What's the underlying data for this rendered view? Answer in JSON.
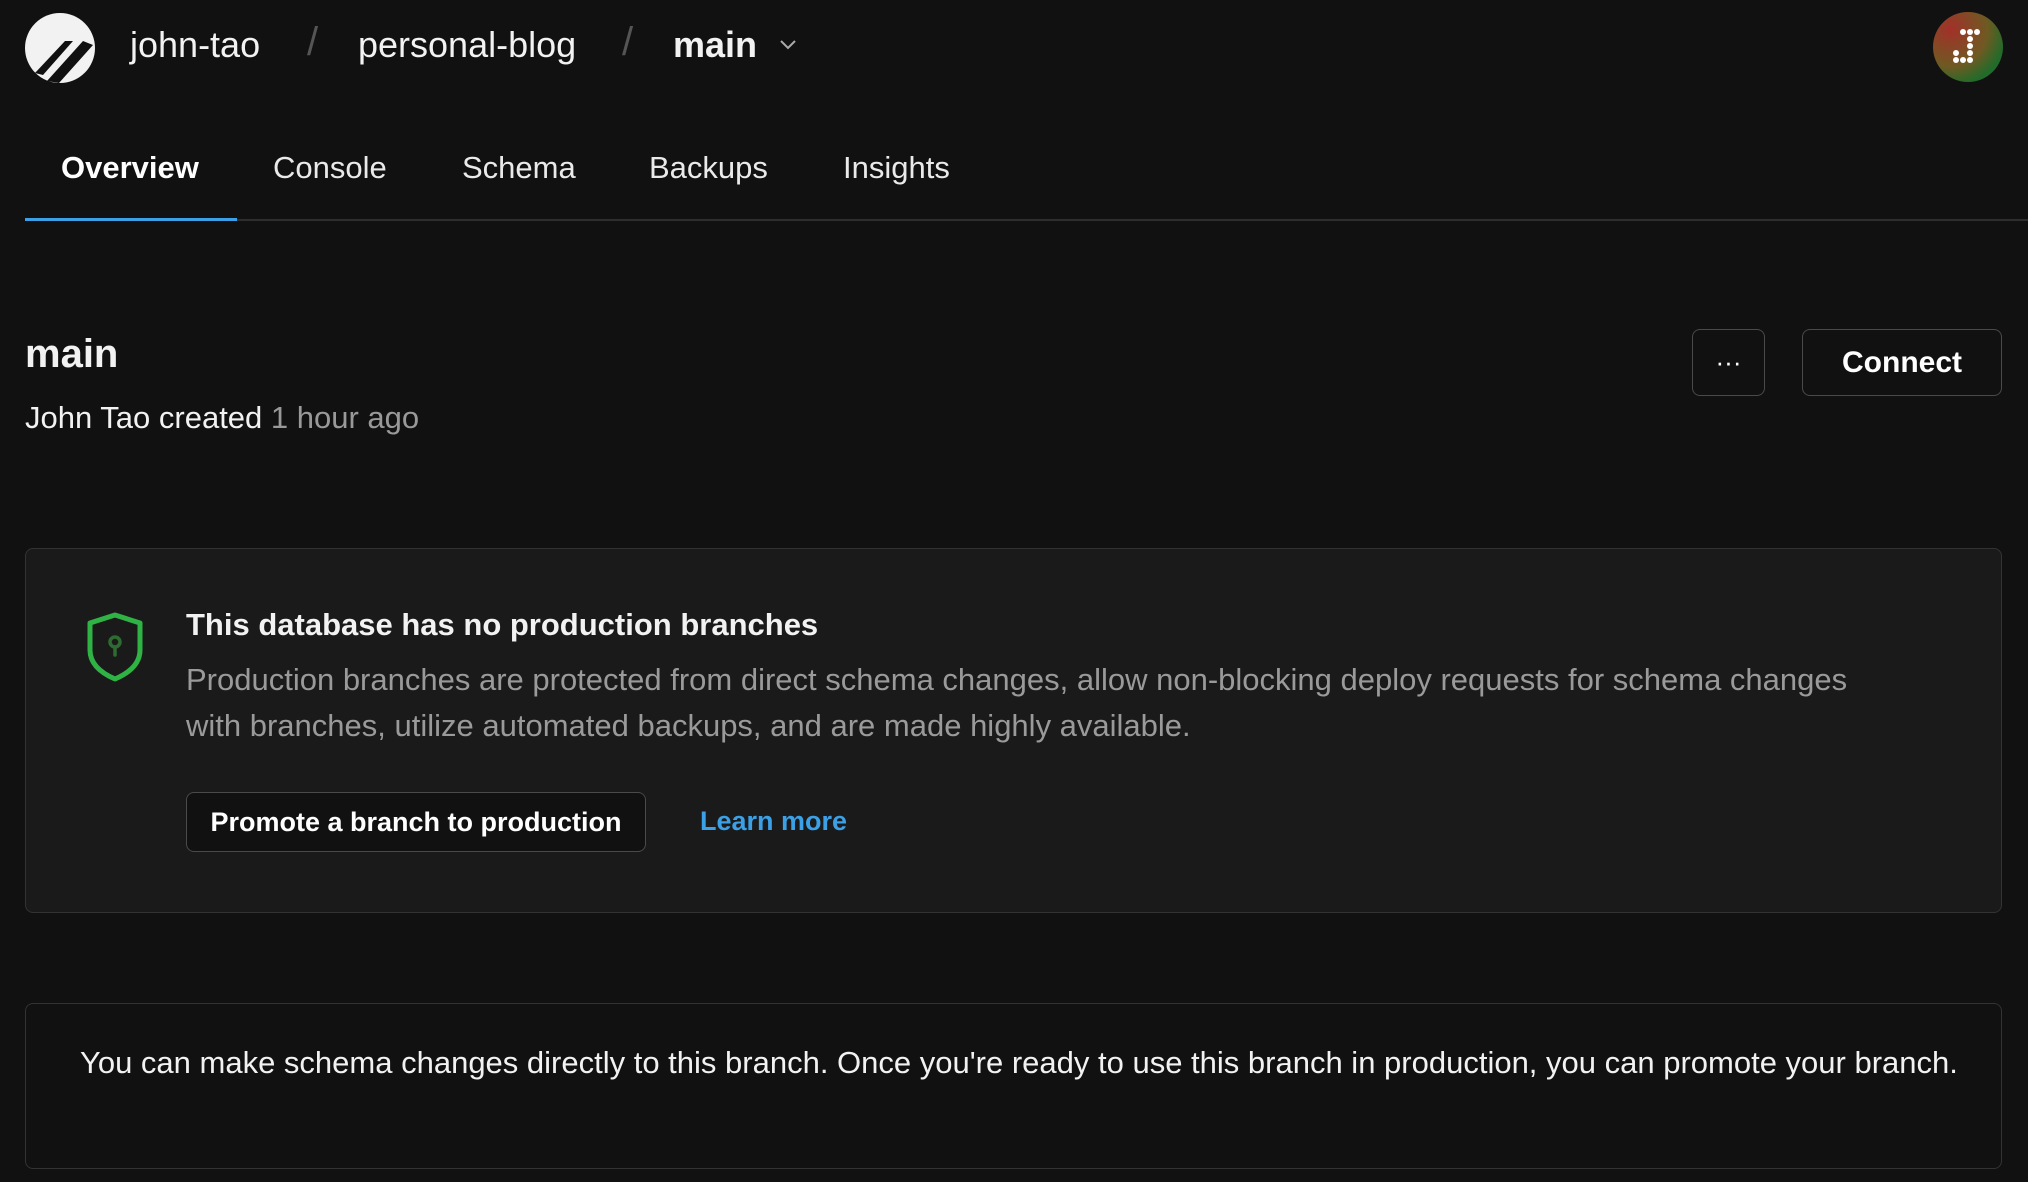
{
  "header": {
    "org": "john-tao",
    "database": "personal-blog",
    "branch": "main",
    "logo_icon": "planetscale-logo",
    "avatar_letter": "J"
  },
  "tabs": [
    {
      "label": "Overview",
      "active": true
    },
    {
      "label": "Console"
    },
    {
      "label": "Schema"
    },
    {
      "label": "Backups"
    },
    {
      "label": "Insights"
    }
  ],
  "branch": {
    "title": "main",
    "author": "John Tao",
    "created_label": "created",
    "time": "1 hour ago",
    "more_label": "···",
    "connect_label": "Connect"
  },
  "notice": {
    "icon": "shield-icon",
    "title": "This database has no production branches",
    "description": "Production branches are protected from direct schema changes, allow non-blocking deploy requests for schema changes with branches, utilize automated backups, and are made highly available.",
    "promote_label": "Promote a branch to production",
    "learn_more_label": "Learn more",
    "accent": "#2fb344",
    "link_color": "#3ba0e6"
  },
  "info": {
    "text": "You can make schema changes directly to this branch. Once you're ready to use this branch in production, you can promote your branch."
  },
  "colors": {
    "tab_underline": "#3ba0e6",
    "background": "#111111"
  }
}
